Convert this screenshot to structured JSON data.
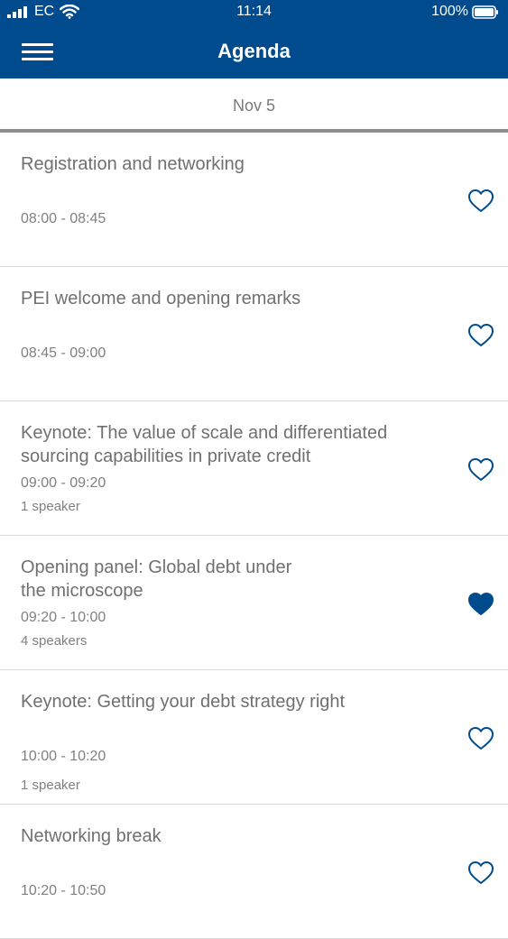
{
  "status_bar": {
    "carrier": "EC",
    "time": "11:14",
    "battery": "100%"
  },
  "header": {
    "title": "Agenda",
    "menu_icon": "hamburger-menu-icon",
    "background": "#004b8d"
  },
  "date_tab": {
    "label": "Nov 5"
  },
  "agenda": [
    {
      "title_lines": [
        "Registration and networking"
      ],
      "time": "08:00 - 08:45",
      "speakers": "",
      "favorited": false
    },
    {
      "title_lines": [
        "PEI welcome and opening remarks"
      ],
      "time": "08:45 - 09:00",
      "speakers": "",
      "favorited": false
    },
    {
      "title_lines": [
        "Keynote: The value of scale and differentiated",
        "sourcing capabilities in private credit"
      ],
      "time": "09:00 - 09:20",
      "speakers": "1 speaker",
      "favorited": false
    },
    {
      "title_lines": [
        "Opening panel: Global debt under",
        "the microscope"
      ],
      "time": "09:20 - 10:00",
      "speakers": "4 speakers",
      "favorited": true
    },
    {
      "title_lines": [
        "Keynote: Getting your debt strategy right"
      ],
      "time": "10:00 - 10:20",
      "speakers": "1 speaker",
      "favorited": false
    },
    {
      "title_lines": [
        "Networking break"
      ],
      "time": "10:20 - 10:50",
      "speakers": "",
      "favorited": false
    }
  ],
  "colors": {
    "accent": "#004b8d",
    "text": "#707070",
    "divider": "#d9d9d9"
  }
}
